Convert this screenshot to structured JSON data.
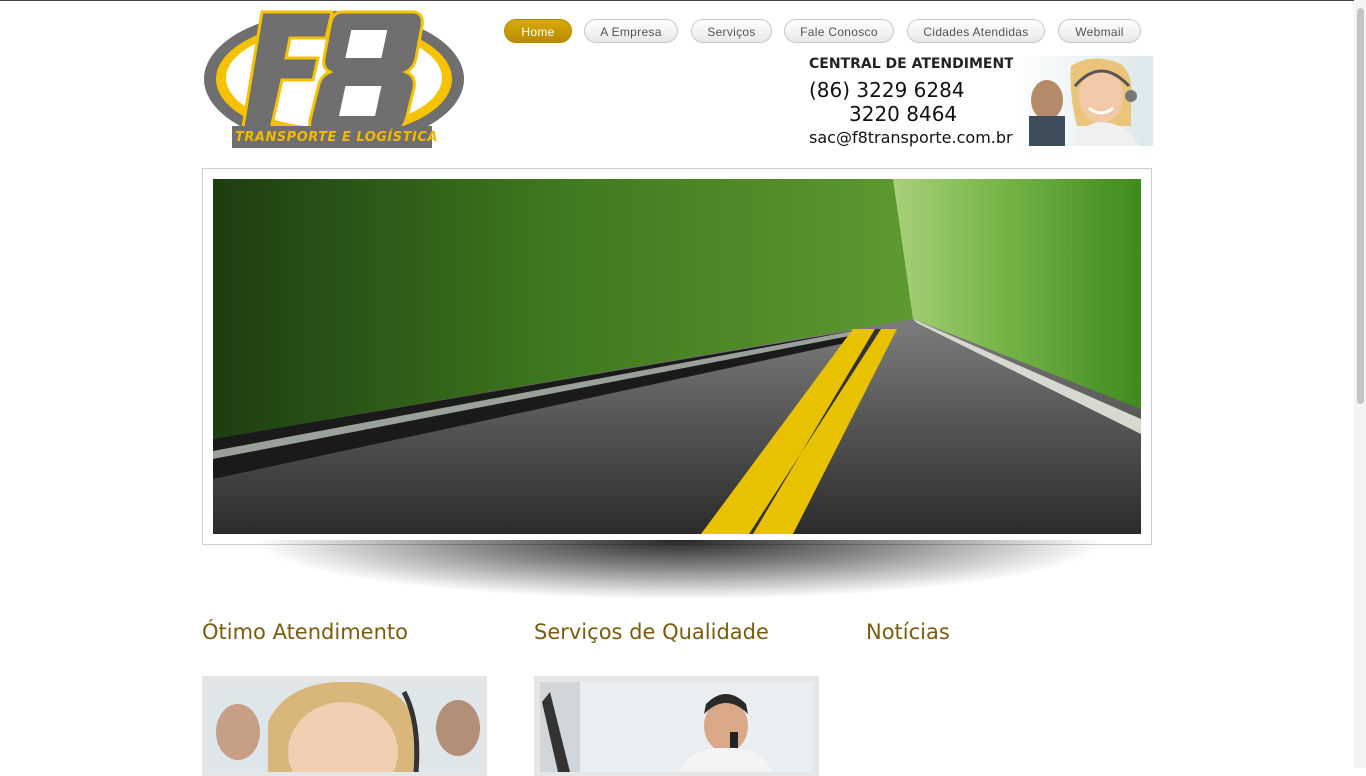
{
  "brand": {
    "logo_letters": "F8",
    "tagline": "TRANSPORTE E LOGÍSTICA"
  },
  "nav": {
    "items": [
      {
        "label": "Home",
        "active": true
      },
      {
        "label": "A Empresa",
        "active": false
      },
      {
        "label": "Serviços",
        "active": false
      },
      {
        "label": "Fale Conosco",
        "active": false
      },
      {
        "label": "Cidades Atendidas",
        "active": false
      },
      {
        "label": "Webmail",
        "active": false
      }
    ]
  },
  "contact": {
    "title": "CENTRAL DE ATENDIMENTO",
    "phone1": "(86) 3229 6284",
    "phone2": "3220 8464",
    "email": "sac@f8transporte.com.br"
  },
  "sections": [
    {
      "title": "Ótimo Atendimento"
    },
    {
      "title": "Serviços de Qualidade"
    },
    {
      "title": "Notícias"
    }
  ],
  "colors": {
    "accent": "#c99b00",
    "logo_gray": "#707070",
    "logo_yellow": "#f5c200",
    "heading": "#7a5c0f"
  }
}
